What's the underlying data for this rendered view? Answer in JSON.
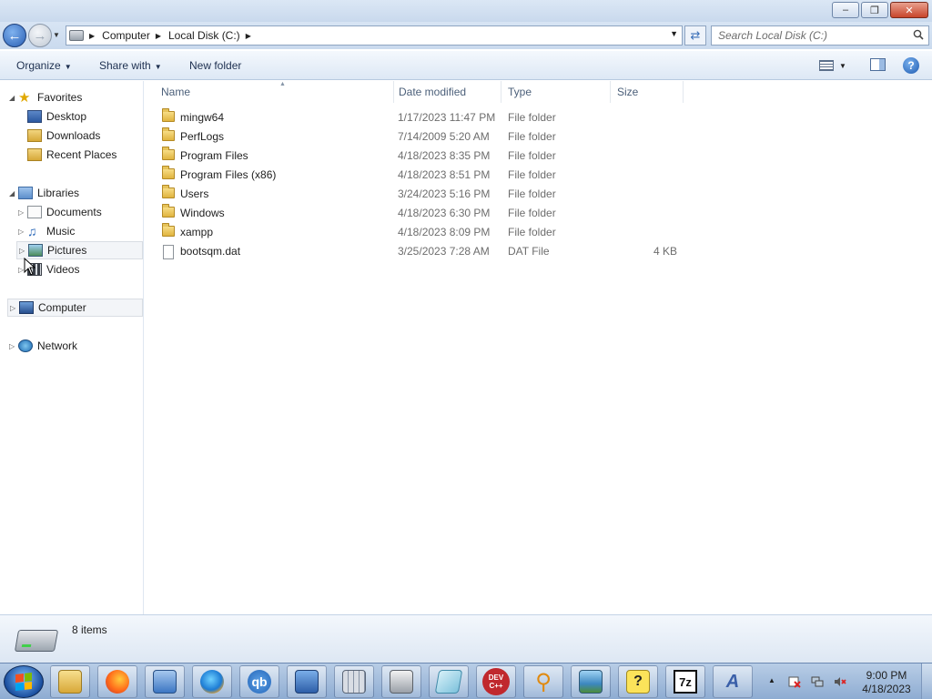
{
  "window": {
    "minimize_label": "–",
    "maximize_label": "❐",
    "close_label": "✕"
  },
  "address": {
    "crumbs": [
      "Computer",
      "Local Disk (C:)"
    ],
    "search_placeholder": "Search Local Disk (C:)"
  },
  "toolbar": {
    "organize": "Organize",
    "share_with": "Share with",
    "new_folder": "New folder"
  },
  "nav": {
    "favorites": "Favorites",
    "desktop": "Desktop",
    "downloads": "Downloads",
    "recent_places": "Recent Places",
    "libraries": "Libraries",
    "documents": "Documents",
    "music": "Music",
    "pictures": "Pictures",
    "videos": "Videos",
    "computer": "Computer",
    "network": "Network"
  },
  "columns": {
    "name": "Name",
    "date_modified": "Date modified",
    "type": "Type",
    "size": "Size"
  },
  "files": [
    {
      "name": "mingw64",
      "date": "1/17/2023 11:47 PM",
      "type": "File folder",
      "size": "",
      "kind": "folder"
    },
    {
      "name": "PerfLogs",
      "date": "7/14/2009 5:20 AM",
      "type": "File folder",
      "size": "",
      "kind": "folder"
    },
    {
      "name": "Program Files",
      "date": "4/18/2023 8:35 PM",
      "type": "File folder",
      "size": "",
      "kind": "folder"
    },
    {
      "name": "Program Files (x86)",
      "date": "4/18/2023 8:51 PM",
      "type": "File folder",
      "size": "",
      "kind": "folder"
    },
    {
      "name": "Users",
      "date": "3/24/2023 5:16 PM",
      "type": "File folder",
      "size": "",
      "kind": "folder"
    },
    {
      "name": "Windows",
      "date": "4/18/2023 6:30 PM",
      "type": "File folder",
      "size": "",
      "kind": "folder"
    },
    {
      "name": "xampp",
      "date": "4/18/2023 8:09 PM",
      "type": "File folder",
      "size": "",
      "kind": "folder"
    },
    {
      "name": "bootsqm.dat",
      "date": "3/25/2023 7:28 AM",
      "type": "DAT File",
      "size": "4 KB",
      "kind": "file"
    }
  ],
  "status": {
    "item_count": "8 items"
  },
  "taskbar": {
    "apps": [
      {
        "icon": "windows-explorer-icon",
        "label": ""
      },
      {
        "icon": "firefox-icon",
        "label": ""
      },
      {
        "icon": "control-panel-icon",
        "label": ""
      },
      {
        "icon": "browser-icon",
        "label": ""
      },
      {
        "icon": "qbittorrent-icon",
        "label": "qb"
      },
      {
        "icon": "remote-desktop-icon",
        "label": ""
      },
      {
        "icon": "calculator-icon",
        "label": ""
      },
      {
        "icon": "printer-icon",
        "label": ""
      },
      {
        "icon": "notepad-icon",
        "label": ""
      },
      {
        "icon": "devcpp-icon",
        "label": "DEV C++"
      },
      {
        "icon": "magnifier-icon",
        "label": ""
      },
      {
        "icon": "photo-viewer-icon",
        "label": ""
      },
      {
        "icon": "help-icon",
        "label": ""
      },
      {
        "icon": "7zip-icon",
        "label": "7z"
      },
      {
        "icon": "text-editor-icon",
        "label": ""
      }
    ],
    "clock_time": "9:00 PM",
    "clock_date": "4/18/2023"
  },
  "colors": {
    "accent": "#2a5fb4",
    "selection": "#f3f5f8",
    "folder": "#e0b43e"
  }
}
